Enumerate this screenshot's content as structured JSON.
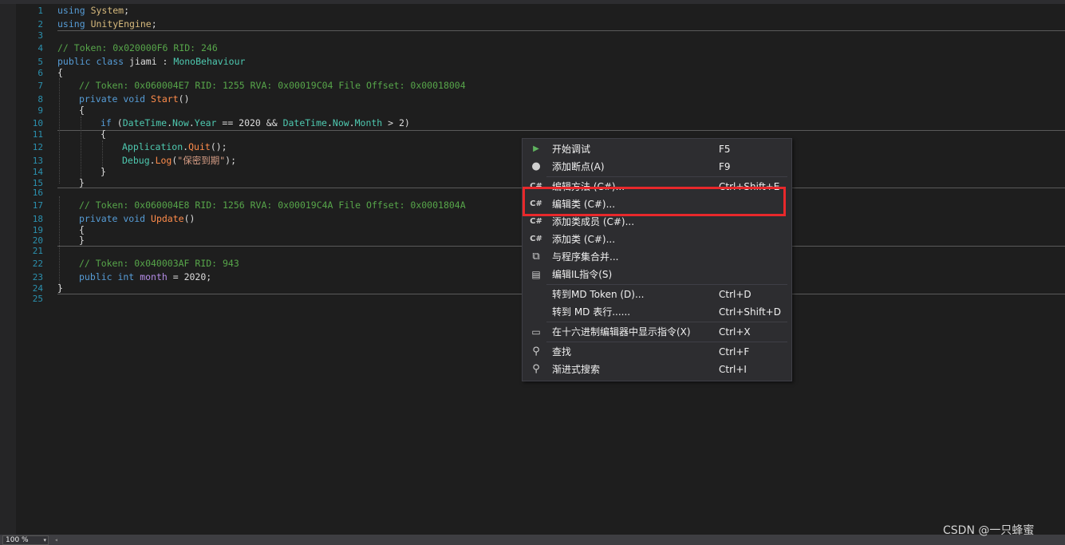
{
  "editor": {
    "line_numbers": [
      "1",
      "2",
      "3",
      "4",
      "5",
      "6",
      "7",
      "8",
      "9",
      "10",
      "11",
      "12",
      "13",
      "14",
      "15",
      "16",
      "17",
      "18",
      "19",
      "20",
      "21",
      "22",
      "23",
      "24",
      "25"
    ],
    "code": {
      "l1_kw": "using",
      "l1_ns": "System",
      "l1_semi": ";",
      "l2_kw": "using",
      "l2_ns": "UnityEngine",
      "l2_semi": ";",
      "l4": "// Token: 0x020000F6 RID: 246",
      "l5_kw": "public class",
      "l5_name": " jiami : ",
      "l5_base": "MonoBehaviour",
      "l6": "{",
      "l7": "// Token: 0x060004E7 RID: 1255 RVA: 0x00019C04 File Offset: 0x00018004",
      "l8_kw": "private void",
      "l8_fn": "Start",
      "l8_paren": "()",
      "l9": "{",
      "l10_kw": "if",
      "l10_open": " (",
      "l10_dt1": "DateTime",
      "l10_d1": ".",
      "l10_now1": "Now",
      "l10_d2": ".",
      "l10_year": "Year",
      "l10_mid": " == 2020 && ",
      "l10_dt2": "DateTime",
      "l10_d3": ".",
      "l10_now2": "Now",
      "l10_d4": ".",
      "l10_month": "Month",
      "l10_end": " > 2)",
      "l11": "{",
      "l12_cls": "Application",
      "l12_dot": ".",
      "l12_fn": "Quit",
      "l12_end": "();",
      "l13_cls": "Debug",
      "l13_dot": ".",
      "l13_fn": "Log",
      "l13_open": "(",
      "l13_str": "\"保密到期\"",
      "l13_end": ");",
      "l14": "}",
      "l15": "}",
      "l17": "// Token: 0x060004E8 RID: 1256 RVA: 0x00019C4A File Offset: 0x0001804A",
      "l18_kw": "private void",
      "l18_fn": "Update",
      "l18_paren": "()",
      "l19": "{",
      "l20": "}",
      "l22": "// Token: 0x040003AF RID: 943",
      "l23_kw": "public int",
      "l23_fld": "month",
      "l23_end": " = 2020;",
      "l24": "}"
    }
  },
  "context_menu": {
    "items": [
      {
        "icon": "play-icon",
        "glyph": "▶",
        "label": "开始调试",
        "shortcut": "F5"
      },
      {
        "icon": "breakpoint-icon",
        "glyph": "●",
        "label": "添加断点(A)",
        "shortcut": "F9"
      },
      {
        "icon": "csharp-icon",
        "glyph": "C#",
        "label": "编辑方法 (C#)...",
        "shortcut": "Ctrl+Shift+E"
      },
      {
        "icon": "csharp-icon",
        "glyph": "C#",
        "label": "编辑类 (C#)...",
        "shortcut": ""
      },
      {
        "icon": "csharp-icon",
        "glyph": "C#",
        "label": "添加类成员 (C#)...",
        "shortcut": ""
      },
      {
        "icon": "csharp-icon",
        "glyph": "C#",
        "label": "添加类 (C#)...",
        "shortcut": ""
      },
      {
        "icon": "merge-icon",
        "glyph": "⧉",
        "label": "与程序集合并...",
        "shortcut": ""
      },
      {
        "icon": "il-icon",
        "glyph": "▤",
        "label": "编辑IL指令(S)",
        "shortcut": ""
      },
      {
        "icon": "",
        "glyph": "",
        "label": "转到MD Token (D)...",
        "shortcut": "Ctrl+D"
      },
      {
        "icon": "",
        "glyph": "",
        "label": "转到 MD 表行......",
        "shortcut": "Ctrl+Shift+D"
      },
      {
        "icon": "hex-icon",
        "glyph": "▭",
        "label": "在十六进制编辑器中显示指令(X)",
        "shortcut": "Ctrl+X"
      },
      {
        "icon": "search-icon",
        "glyph": "⚲",
        "label": "查找",
        "shortcut": "Ctrl+F"
      },
      {
        "icon": "search-icon",
        "glyph": "⚲",
        "label": "渐进式搜索",
        "shortcut": "Ctrl+I"
      }
    ]
  },
  "status": {
    "zoom": "100 %",
    "zoom_arrow": "▾",
    "scroll_left": "◂"
  },
  "watermark": "CSDN @一只蜂蜜",
  "colors": {
    "highlight": "#e8282b",
    "keyword": "#569cd6",
    "type": "#4ec9b0",
    "comment": "#57a64a",
    "method": "#ff8c4b"
  }
}
